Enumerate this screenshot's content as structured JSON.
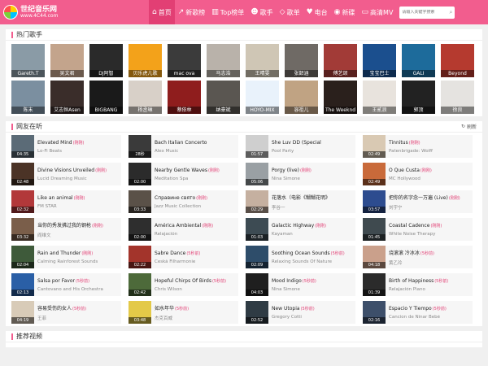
{
  "header": {
    "logo_title": "世纪音乐网",
    "logo_url": "www.4C44.com",
    "nav": [
      {
        "label": "首页",
        "icon": "⌂",
        "active": true
      },
      {
        "label": "新歌榜",
        "icon": "↗"
      },
      {
        "label": "Top榜单",
        "icon": "▥"
      },
      {
        "label": "歌手",
        "icon": "☻"
      },
      {
        "label": "歌单",
        "icon": "◇"
      },
      {
        "label": "电台",
        "icon": "♥"
      },
      {
        "label": "新碟",
        "icon": "◉"
      },
      {
        "label": "高清MV",
        "icon": "▭"
      }
    ],
    "search_placeholder": "请输入关键字搜索"
  },
  "hot_singers": {
    "title": "热门歌手",
    "items": [
      {
        "name": "Gareth.T",
        "color": "#8a9ba6"
      },
      {
        "name": "吴文君",
        "color": "#c3a48c"
      },
      {
        "name": "DJ阿智",
        "color": "#2a2a2a"
      },
      {
        "name": "贝乐虎儿歌",
        "color": "#f3a21a"
      },
      {
        "name": "mac ova",
        "color": "#3b3b3b"
      },
      {
        "name": "马志浩",
        "color": "#b9b2aa"
      },
      {
        "name": "王晴雯",
        "color": "#cfc6b5"
      },
      {
        "name": "张韶涵",
        "color": "#6f6a65"
      },
      {
        "name": "傅艺颂",
        "color": "#a23b37"
      },
      {
        "name": "宝宝巴士",
        "color": "#1b4f8e"
      },
      {
        "name": "GALI",
        "color": "#1d6b9b"
      },
      {
        "name": "Beyond",
        "color": "#b53a2f"
      },
      {
        "name": "陈末",
        "color": "#7b8fa0"
      },
      {
        "name": "艾志恒Asen",
        "color": "#3a2d2a"
      },
      {
        "name": "BIGBANG",
        "color": "#1a1a1a"
      },
      {
        "name": "杨丞琳",
        "color": "#d8d0c8"
      },
      {
        "name": "蔡依林",
        "color": "#8f1d1d"
      },
      {
        "name": "纳豪斌",
        "color": "#5a5651"
      },
      {
        "name": "HOYO-MIX",
        "color": "#e9f2fb"
      },
      {
        "name": "容祖儿",
        "color": "#c0a383"
      },
      {
        "name": "The Weeknd",
        "color": "#2a201c"
      },
      {
        "name": "王贰浪",
        "color": "#e8e3dd"
      },
      {
        "name": "郭顶",
        "color": "#222"
      },
      {
        "name": "徐良",
        "color": "#e5e3e0"
      }
    ]
  },
  "friends_listening": {
    "title": "网友在听",
    "refresh_label": "刷新",
    "songs": [
      {
        "title": "Elevated Mind",
        "tag": "(刚刚)",
        "artist": "Lo-Fi Beats",
        "duration": "04:35",
        "color": "#5b6b77"
      },
      {
        "title": "Bach Italian Concerto",
        "tag": "",
        "artist": "Alex Music",
        "duration": "28秒",
        "color": "#3a3a3a"
      },
      {
        "title": "She Luv DD (Special",
        "tag": "",
        "artist": "Pool Party",
        "duration": "01:57",
        "color": "#cfcfcf"
      },
      {
        "title": "Tinnitus",
        "tag": "(刚刚)",
        "artist": "Patenbrigade: Wolff",
        "duration": "02:49",
        "color": "#d9c9b3"
      },
      {
        "title": "Divine Visions Unveiled",
        "tag": "(刚刚)",
        "artist": "Lucid Dreaming Music",
        "duration": "02:48",
        "color": "#4b3326"
      },
      {
        "title": "Nearby Gentle Waves",
        "tag": "(刚刚)",
        "artist": "Meditation Spa",
        "duration": "02:00",
        "color": "#2b2b2b"
      },
      {
        "title": "Porgy (live)",
        "tag": "(刚刚)",
        "artist": "Nina Simone",
        "duration": "05:06",
        "color": "#9aa0a4"
      },
      {
        "title": "O Que Custa",
        "tag": "(刚刚)",
        "artist": "MC Hollywood",
        "duration": "02:49",
        "color": "#c96a3a"
      },
      {
        "title": "Like an animal",
        "tag": "(刚刚)",
        "artist": "FM STAR",
        "duration": "02:32",
        "color": "#b2383a"
      },
      {
        "title": "Справине свято",
        "tag": "(刚刚)",
        "artist": "Jazz Music Collection",
        "duration": "03:33",
        "color": "#5a5148"
      },
      {
        "title": "花落水（电影《糊糊花明》",
        "tag": "",
        "artist": "李谷一",
        "duration": "02:29",
        "color": "#c5b0a0"
      },
      {
        "title": "把你的名字念一万遍 (Live)",
        "tag": "(刚刚)",
        "artist": "刘宇宁",
        "duration": "03:57",
        "color": "#2d4c8f"
      },
      {
        "title": "当你的秀发拂过我的钢枪",
        "tag": "(刚刚)",
        "artist": "阎维文",
        "duration": "03:32",
        "color": "#7a5e4a"
      },
      {
        "title": "América Ambiental",
        "tag": "(刚刚)",
        "artist": "Relajación",
        "duration": "02:00",
        "color": "#2e2e2e"
      },
      {
        "title": "Galactic Highway",
        "tag": "(刚刚)",
        "artist": "Kayaman",
        "duration": "01:03",
        "color": "#3d4b53"
      },
      {
        "title": "Coastal Cadence",
        "tag": "(刚刚)",
        "artist": "White Noise Therapy",
        "duration": "01:45",
        "color": "#3f4a4f"
      },
      {
        "title": "Rain and Thunder",
        "tag": "(刚刚)",
        "artist": "Calming Rainforest Sounds",
        "duration": "02:04",
        "color": "#3e5a3a"
      },
      {
        "title": "Sabre Dance",
        "tag": "(5秒前)",
        "artist": "Ceská Filharmonie",
        "duration": "02:22",
        "color": "#a3342b"
      },
      {
        "title": "Soothing Ocean Sounds",
        "tag": "(5秒前)",
        "artist": "Relaxing Sounds Of Nature",
        "duration": "02:09",
        "color": "#2e4d6a"
      },
      {
        "title": "烧滚滚 冷冰冰",
        "tag": "(5秒前)",
        "artist": "黄乙玲",
        "duration": "04:18",
        "color": "#caa08b"
      },
      {
        "title": "Salsa por Favor",
        "tag": "(5秒前)",
        "artist": "Cantovano and His Orchestra",
        "duration": "02:13",
        "color": "#2a5fa6"
      },
      {
        "title": "Hopeful Chirps Of Birds",
        "tag": "(5秒前)",
        "artist": "Chris Wilson",
        "duration": "02:42",
        "color": "#4d6a3a"
      },
      {
        "title": "Mood Indigo",
        "tag": "(5秒前)",
        "artist": "Nina Simone",
        "duration": "04:03",
        "color": "#1f1f1f"
      },
      {
        "title": "Birth of Happiness",
        "tag": "(5秒前)",
        "artist": "Relajación Piano",
        "duration": "01:39",
        "color": "#2b2b2b"
      },
      {
        "title": "容易受伤的女人",
        "tag": "(5秒前)",
        "artist": "王菲",
        "duration": "04:19",
        "color": "#d8cbb8"
      },
      {
        "title": "如水年华",
        "tag": "(5秒前)",
        "artist": "杰克百威",
        "duration": "03:48",
        "color": "#e3c948"
      },
      {
        "title": "New Utopia",
        "tag": "(5秒前)",
        "artist": "Gregory Cotti",
        "duration": "02:52",
        "color": "#2f3b44"
      },
      {
        "title": "Espacio Y Tiempo",
        "tag": "(5秒前)",
        "artist": "Cancion de Ninar Bebé",
        "duration": "02:16",
        "color": "#3d4f6a"
      }
    ]
  },
  "recommend_mv": {
    "title": "推荐视频"
  }
}
